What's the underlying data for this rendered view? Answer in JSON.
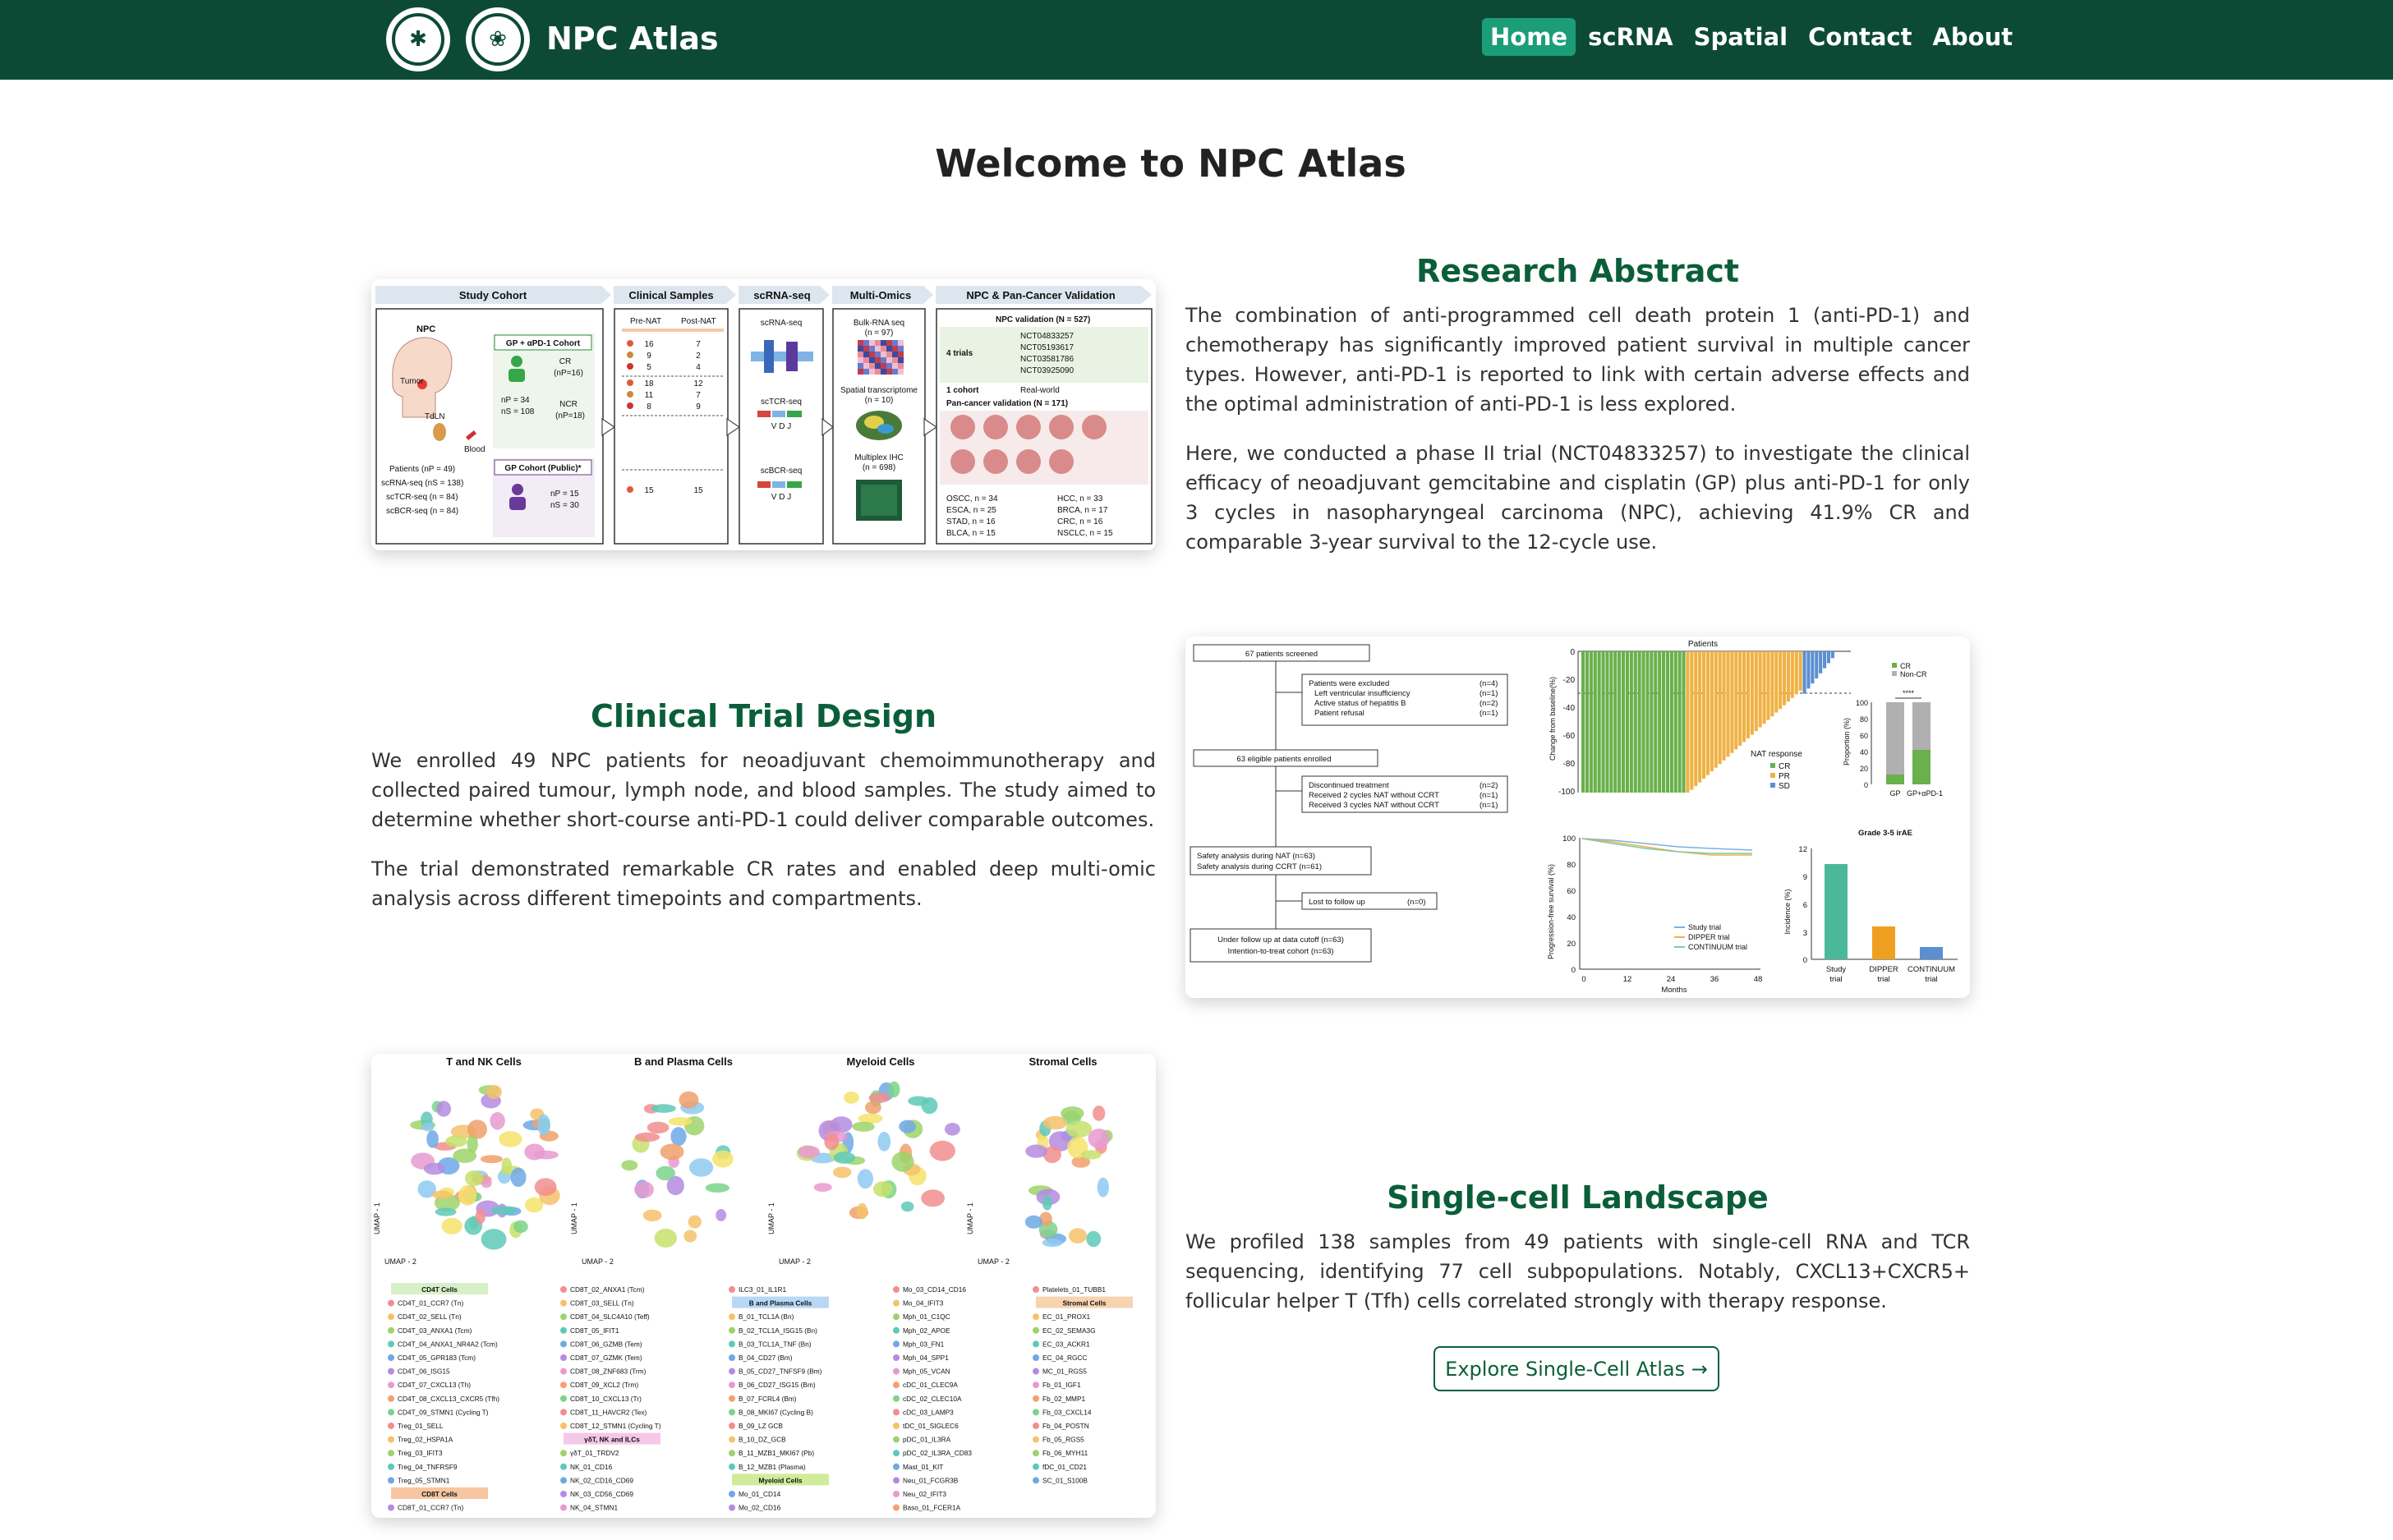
{
  "nav": {
    "brand": "NPC Atlas",
    "items": [
      {
        "label": "Home",
        "active": true
      },
      {
        "label": "scRNA",
        "active": false
      },
      {
        "label": "Spatial",
        "active": false
      },
      {
        "label": "Contact",
        "active": false
      },
      {
        "label": "About",
        "active": false
      }
    ]
  },
  "welcome": "Welcome to NPC Atlas",
  "abstract": {
    "title": "Research Abstract",
    "p1": "The combination of anti-programmed cell death protein 1 (anti-PD-1) and chemotherapy has significantly improved patient survival in multiple cancer types. However, anti-PD-1 is reported to link with certain adverse effects and the optimal administration of anti-PD-1 is less explored.",
    "p2": "Here, we conducted a phase II trial (NCT04833257) to investigate the clinical efficacy of neoadjuvant gemcitabine and cisplatin (GP) plus anti-PD-1 for only 3 cycles in nasopharyngeal carcinoma (NPC), achieving 41.9% CR and comparable 3-year survival to the 12-cycle use."
  },
  "trial": {
    "title": "Clinical Trial Design",
    "p1": "We enrolled 49 NPC patients for neoadjuvant chemoimmunotherapy and collected paired tumour, lymph node, and blood samples. The study aimed to determine whether short-course anti-PD-1 could deliver comparable outcomes.",
    "p2": "The trial demonstrated remarkable CR rates and enabled deep multi-omic analysis across different timepoints and compartments."
  },
  "singlecell": {
    "title": "Single-cell Landscape",
    "p1": "We profiled 138 samples from 49 patients with single-cell RNA and TCR sequencing, identifying 77 cell subpopulations. Notably, CXCL13+CXCR5+ follicular helper T (Tfh) cells correlated strongly with therapy response.",
    "button": "Explore Single-Cell Atlas →"
  },
  "fig1": {
    "headers": [
      "Study Cohort",
      "Clinical Samples",
      "scRNA-seq",
      "Multi-Omics",
      "NPC & Pan-Cancer Validation"
    ],
    "npc": "NPC",
    "tumor": "Tumor",
    "tdln": "TdLN",
    "blood": "Blood",
    "cohort1": "GP + αPD-1 Cohort",
    "cr": "CR",
    "cr_n": "(nP=16)",
    "np34": "nP = 34",
    "ns108": "nS = 108",
    "ncr": "NCR",
    "ncr_n": "(nP=18)",
    "cohort2": "GP Cohort (Public)*",
    "np15": "nP = 15",
    "ns30": "nS = 30",
    "patients": "Patients (nP = 49)",
    "scrna": "scRNA-seq (nS = 138)",
    "sctcr": "scTCR-seq (n = 84)",
    "scbcr": "scBCR-seq (n = 84)",
    "prenat": "Pre-NAT",
    "postnat": "Post-NAT",
    "samples": [
      [
        "16",
        "7"
      ],
      [
        "9",
        "2"
      ],
      [
        "5",
        "4"
      ],
      [
        "18",
        "12"
      ],
      [
        "11",
        "7"
      ],
      [
        "8",
        "9"
      ],
      [
        "15",
        "15"
      ]
    ],
    "scrna_lbl": "scRNA-seq",
    "sctcr_lbl": "scTCR-seq",
    "scbcr_lbl": "scBCR-seq",
    "vdj": "V  D  J",
    "bulk": "Bulk-RNA seq",
    "bulk_n": "(n = 97)",
    "spatial": "Spatial transcriptome",
    "spatial_n": "(n = 10)",
    "ihc": "Multiplex IHC",
    "ihc_n": "(n = 698)",
    "npcval": "NPC validation (N = 527)",
    "trials4": "4 trials",
    "ncts": [
      "NCT04833257",
      "NCT05193617",
      "NCT03581786",
      "NCT03925090"
    ],
    "cohort1b": "1 cohort",
    "realworld": "Real-world",
    "panval": "Pan-cancer validation (N = 171)",
    "cancers_left": [
      "OSCC, n = 34",
      "ESCA, n = 25",
      "STAD, n = 16",
      "BLCA, n = 15"
    ],
    "cancers_right": [
      "HCC, n = 33",
      "BRCA, n = 17",
      "CRC, n = 16",
      "NSCLC, n = 15"
    ]
  },
  "fig2": {
    "screened": "67 patients screened",
    "excluded": [
      "Patients were excluded",
      "Left ventricular insufficiency",
      "Active status of hepatitis B",
      "Patient refusal"
    ],
    "excluded_n": [
      "(n=4)",
      "(n=1)",
      "(n=2)",
      "(n=1)"
    ],
    "eligible": "63 eligible patients enrolled",
    "discont": [
      "Discontinued treatment",
      "Received 2 cycles NAT without CCRT",
      "Received 3 cycles NAT without CCRT"
    ],
    "discont_n": [
      "(n=2)",
      "(n=1)",
      "(n=1)"
    ],
    "safety": [
      "Safety analysis during NAT (n=63)",
      "Safety analysis during CCRT (n=61)"
    ],
    "lost": "Lost to follow up",
    "lost_n": "(n=0)",
    "under": [
      "Under follow up at data cutoff (n=63)",
      "Intention-to-treat cohort (n=63)"
    ],
    "waterfall_title": "Patients",
    "waterfall_ylabel": "Change from baseline(%)",
    "waterfall_yticks": [
      "0",
      "-20",
      "-40",
      "-60",
      "-80",
      "-100"
    ],
    "nat_response": "NAT response",
    "legend_resp": [
      "CR",
      "PR",
      "SD"
    ],
    "legend_cr": [
      "CR",
      "Non-CR"
    ],
    "prop_ylabel": "Proportion (%)",
    "prop_yticks": [
      "100",
      "80",
      "60",
      "40",
      "20",
      "0"
    ],
    "prop_x": [
      "GP",
      "GP+αPD-1"
    ],
    "prop_sig": "****",
    "pfs_ylabel": "Progression-free survival (%)",
    "pfs_yticks": [
      "100",
      "80",
      "60",
      "40",
      "20",
      "0"
    ],
    "pfs_xticks": [
      "0",
      "12",
      "24",
      "36",
      "48"
    ],
    "pfs_xlabel": "Months",
    "pfs_legend": [
      "Study trial",
      "DIPPER trial",
      "CONTINUUM trial"
    ],
    "irae_title": "Grade 3-5 irAE",
    "irae_ylabel": "Incidence (%)",
    "irae_yticks": [
      "12",
      "9",
      "6",
      "3",
      "0"
    ],
    "irae_x": [
      [
        "Study",
        "trial"
      ],
      [
        "DIPPER",
        "trial"
      ],
      [
        "CONTINUUM",
        "trial"
      ]
    ]
  },
  "fig3": {
    "panels": [
      "T and NK Cells",
      "B and Plasma Cells",
      "Myeloid Cells",
      "Stromal Cells"
    ],
    "umap1": "UMAP - 1",
    "umap2": "UMAP - 2",
    "col1": {
      "h1": "CD4T Cells",
      "items1": [
        "CD4T_01_CCR7 (Tn)",
        "CD4T_02_SELL (Tn)",
        "CD4T_03_ANXA1 (Tcm)",
        "CD4T_04_ANXA1_NR4A2 (Tcm)",
        "CD4T_05_GPR183 (Tcm)",
        "CD4T_06_ISG15",
        "CD4T_07_CXCL13 (Th)",
        "CD4T_08_CXCL13_CXCR5 (Tfh)",
        "CD4T_09_STMN1 (Cycling T)",
        "Treg_01_SELL",
        "Treg_02_HSPA1A",
        "Treg_03_IFIT3",
        "Treg_04_TNFRSF9",
        "Treg_05_STMN1"
      ],
      "h2": "CD8T Cells",
      "items2": [
        "CD8T_01_CCR7 (Tn)"
      ]
    },
    "col2": {
      "items1": [
        "CD8T_02_ANXA1 (Tcm)",
        "CD8T_03_SELL (Tn)",
        "CD8T_04_SLC4A10 (Teff)",
        "CD8T_05_IFIT1",
        "CD8T_06_GZMB (Tem)",
        "CD8T_07_GZMK (Tem)",
        "CD8T_08_ZNF683 (Trm)",
        "CD8T_09_XCL2 (Trm)",
        "CD8T_10_CXCL13 (Tr)",
        "CD8T_11_HAVCR2 (Tex)",
        "CD8T_12_STMN1 (Cycling T)"
      ],
      "h2": "γδT, NK and ILCs",
      "items2": [
        "γδT_01_TRDV2",
        "NK_01_CD16",
        "NK_02_CD16_CD69",
        "NK_03_CD56_CD69",
        "NK_04_STMN1"
      ]
    },
    "col3": {
      "items0": [
        "ILC3_01_IL1R1"
      ],
      "h1": "B and Plasma Cells",
      "items1": [
        "B_01_TCL1A (Bn)",
        "B_02_TCL1A_ISG15 (Bn)",
        "B_03_TCL1A_TNF (Bn)",
        "B_04_CD27 (Bm)",
        "B_05_CD27_TNFSF9 (Bm)",
        "B_06_CD27_ISG15 (Bm)",
        "B_07_FCRL4 (Bm)",
        "B_08_MKI67 (Cycling B)",
        "B_09_LZ GCB",
        "B_10_DZ_GCB",
        "B_11_MZB1_MKI67 (Pb)",
        "B_12_MZB1 (Plasma)"
      ],
      "h2": "Myeloid Cells",
      "items2": [
        "Mo_01_CD14",
        "Mo_02_CD16"
      ]
    },
    "col4": {
      "items1": [
        "Mo_03_CD14_CD16",
        "Mo_04_IFIT3",
        "Mph_01_C1QC",
        "Mph_02_APOE",
        "Mph_03_FN1",
        "Mph_04_SPP1",
        "Mph_05_VCAN",
        "cDC_01_CLEC9A",
        "cDC_02_CLEC10A",
        "cDC_03_LAMP3",
        "tDC_01_SIGLEC6",
        "pDC_01_IL3RA",
        "pDC_02_IL3RA_CD83",
        "Mast_01_KIT",
        "Neu_01_FCGR3B",
        "Neu_02_IFIT3",
        "Baso_01_FCER1A"
      ]
    },
    "col5": {
      "items0": [
        "Platelets_01_TUBB1"
      ],
      "h1": "Stromal Cells",
      "items1": [
        "EC_01_PROX1",
        "EC_02_SEMA3G",
        "EC_03_ACKR1",
        "EC_04_RGCC",
        "MC_01_RGS5",
        "Fb_01_IGF1",
        "Fb_02_MMP1",
        "Fb_03_CXCL14",
        "Fb_04_POSTN",
        "Fb_05_RGS5",
        "Fb_06_MYH11",
        "fDC_01_CD21",
        "SC_01_S100B"
      ]
    }
  },
  "colors": {
    "nav_bg": "#0d4a36",
    "active": "#1b9e78",
    "title_green": "#0b5e3a",
    "cr": "#6ab04c",
    "pr": "#f0b245",
    "sd": "#5b8fd0"
  }
}
